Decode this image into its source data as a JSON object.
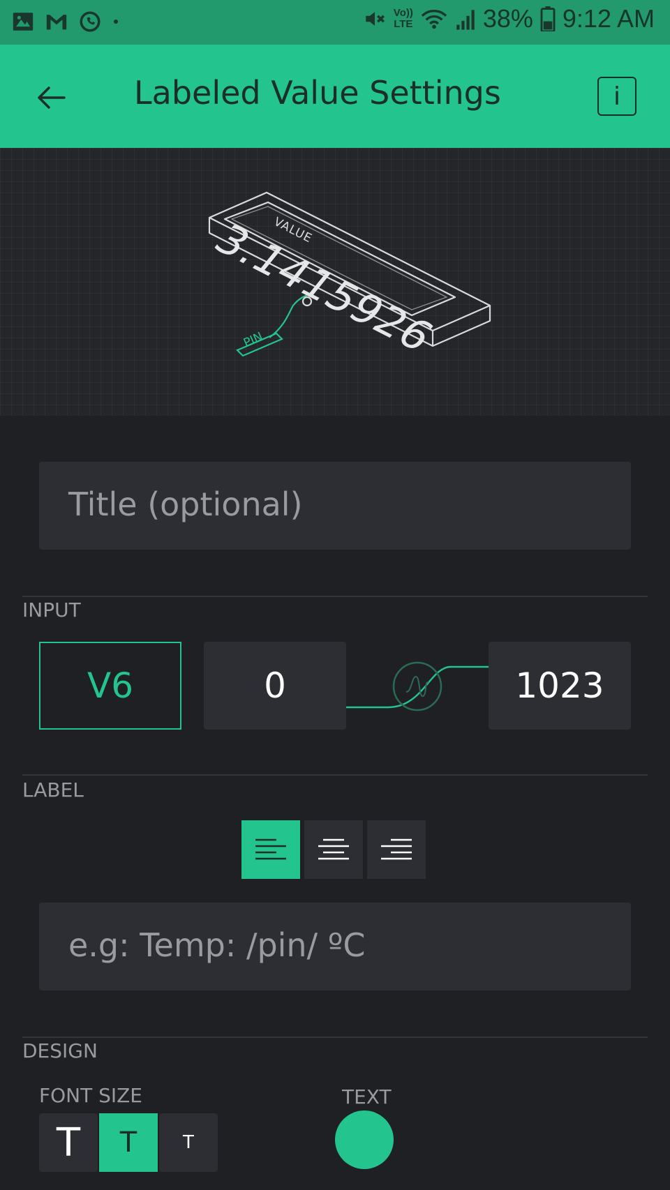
{
  "status_bar": {
    "battery": "38%",
    "time": "9:12 AM",
    "icons": [
      "gallery-icon",
      "gmail-icon",
      "whatsapp-icon",
      "dot-icon",
      "mute-icon",
      "volte-icon",
      "wifi-icon",
      "signal-icon",
      "battery-icon"
    ],
    "volte_line1": "Vo))",
    "volte_line2": "LTE"
  },
  "app_bar": {
    "title": "Labeled Value Settings",
    "info_label": "i"
  },
  "preview": {
    "value_caption": "VALUE",
    "value_text": "3.1415926",
    "pin_label": "PIN"
  },
  "title_field": {
    "placeholder": "Title (optional)",
    "value": ""
  },
  "input_section": {
    "heading": "INPUT",
    "pin": "V6",
    "min": "0",
    "max": "1023"
  },
  "label_section": {
    "heading": "LABEL",
    "alignment_selected": "left",
    "alignment_options": [
      "left",
      "center",
      "right"
    ],
    "placeholder": "e.g: Temp: /pin/ ºC"
  },
  "design_section": {
    "heading": "DESIGN",
    "font_size_label": "FONT SIZE",
    "font_size_options": [
      "T",
      "T",
      "T"
    ],
    "font_size_selected_index": 1,
    "text_color_label": "TEXT",
    "text_color": "#23c48e"
  },
  "colors": {
    "accent": "#23c48e",
    "status_bar": "#239a6d",
    "background": "#1f2024",
    "field": "#2d2e33"
  }
}
